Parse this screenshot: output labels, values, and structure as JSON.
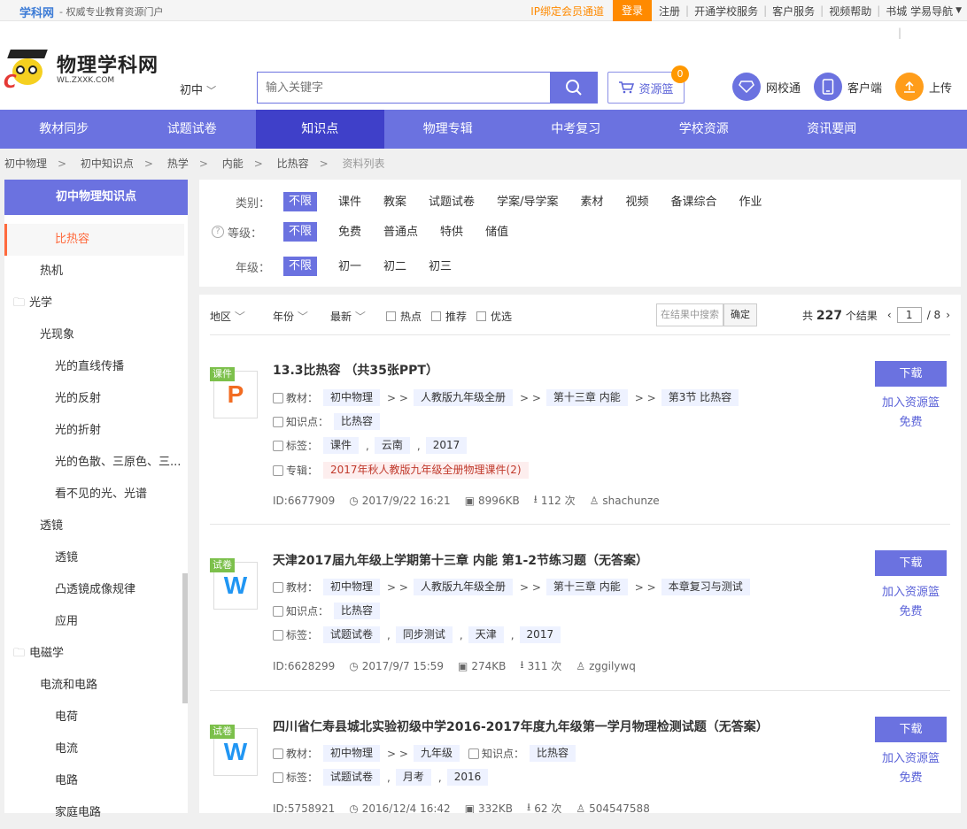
{
  "topbar": {
    "brand": "学科网",
    "slogan": "- 权威专业教育资源门户",
    "links": {
      "vip": "IP绑定会员通道",
      "login": "登录",
      "register": "注册",
      "school": "开通学校服务",
      "service": "客户服务",
      "video": "视频帮助",
      "nav": "书城 学易导航"
    }
  },
  "header": {
    "logo_cn": "物理学科网",
    "logo_en": "WL.ZXXK.COM",
    "level": "初中",
    "search_placeholder": "输入关键字",
    "basket_label": "资源篮",
    "basket_count": "0",
    "links": [
      "网校通",
      "客户端",
      "上传"
    ]
  },
  "nav": [
    "教材同步",
    "试题试卷",
    "知识点",
    "物理专辑",
    "中考复习",
    "学校资源",
    "资讯要闻"
  ],
  "breadcrumb": [
    "初中物理",
    "初中知识点",
    "热学",
    "内能",
    "比热容",
    "资料列表"
  ],
  "sidebar": {
    "title": "初中物理知识点",
    "items": [
      {
        "label": "比热容",
        "level": "sel"
      },
      {
        "label": "热机",
        "level": "l1"
      },
      {
        "label": "光学",
        "level": "l0"
      },
      {
        "label": "光现象",
        "level": "l1"
      },
      {
        "label": "光的直线传播",
        "level": "l2"
      },
      {
        "label": "光的反射",
        "level": "l2"
      },
      {
        "label": "光的折射",
        "level": "l2"
      },
      {
        "label": "光的色散、三原色、三...",
        "level": "l2"
      },
      {
        "label": "看不见的光、光谱",
        "level": "l2"
      },
      {
        "label": "透镜",
        "level": "l1"
      },
      {
        "label": "透镜",
        "level": "l2"
      },
      {
        "label": "凸透镜成像规律",
        "level": "l2"
      },
      {
        "label": "应用",
        "level": "l2"
      },
      {
        "label": "电磁学",
        "level": "l0"
      },
      {
        "label": "电流和电路",
        "level": "l1"
      },
      {
        "label": "电荷",
        "level": "l2"
      },
      {
        "label": "电流",
        "level": "l2"
      },
      {
        "label": "电路",
        "level": "l2"
      },
      {
        "label": "家庭电路",
        "level": "l2"
      }
    ]
  },
  "filters": {
    "category": {
      "label": "类别：",
      "options": [
        "不限",
        "课件",
        "教案",
        "试题试卷",
        "学案/导学案",
        "素材",
        "视频",
        "备课综合",
        "作业"
      ]
    },
    "grade": {
      "label": "等级：",
      "options": [
        "不限",
        "免费",
        "普通点",
        "特供",
        "储值"
      ]
    },
    "year": {
      "label": "年级：",
      "options": [
        "不限",
        "初一",
        "初二",
        "初三"
      ]
    }
  },
  "toolbar": {
    "region": "地区",
    "year": "年份",
    "latest": "最新",
    "checks": [
      "热点",
      "推荐",
      "优选"
    ],
    "search_placeholder": "在结果中搜索",
    "confirm": "确定",
    "count_prefix": "共",
    "count": "227",
    "count_suffix": "个结果",
    "page": "1",
    "pages": "/ 8"
  },
  "results": [
    {
      "type_tag": "课件",
      "icon_letter": "P",
      "title": "13.3比热容 （共35张PPT）",
      "textbook_label": "教材：",
      "textbook": [
        "初中物理",
        "人教版九年级全册",
        "第十三章 内能",
        "第3节 比热容"
      ],
      "kp_label": "知识点：",
      "kp": [
        "比热容"
      ],
      "tag_label": "标签：",
      "tags": [
        "课件",
        "云南",
        "2017"
      ],
      "album_label": "专辑：",
      "album": "2017年秋人教版九年级全册物理课件(2)",
      "id": "ID:6677909",
      "date": "2017/9/22 16:21",
      "size": "8996KB",
      "downloads": "112 次",
      "user": "shachunze",
      "download": "下载",
      "add": "加入资源篮",
      "price": "免费"
    },
    {
      "type_tag": "试卷",
      "icon_letter": "W",
      "title": "天津2017届九年级上学期第十三章 内能 第1-2节练习题（无答案）",
      "textbook_label": "教材：",
      "textbook": [
        "初中物理",
        "人教版九年级全册",
        "第十三章 内能",
        "本章复习与测试"
      ],
      "kp_label": "知识点：",
      "kp": [
        "比热容"
      ],
      "tag_label": "标签：",
      "tags": [
        "试题试卷",
        "同步测试",
        "天津",
        "2017"
      ],
      "id": "ID:6628299",
      "date": "2017/9/7 15:59",
      "size": "274KB",
      "downloads": "311 次",
      "user": "zggilywq",
      "download": "下载",
      "add": "加入资源篮",
      "price": "免费"
    },
    {
      "type_tag": "试卷",
      "icon_letter": "W",
      "title": "四川省仁寿县城北实验初级中学2016-2017年度九年级第一学月物理检测试题（无答案）",
      "textbook_label": "教材：",
      "textbook": [
        "初中物理",
        "九年级"
      ],
      "kp_label": "知识点：",
      "kp": [
        "比热容"
      ],
      "tag_label": "标签：",
      "tags": [
        "试题试卷",
        "月考",
        "2016"
      ],
      "id": "ID:5758921",
      "date": "2016/12/4 16:42",
      "size": "332KB",
      "downloads": "62 次",
      "user": "504547588",
      "download": "下载",
      "add": "加入资源篮",
      "price": "免费"
    }
  ],
  "colors": {
    "primary": "#6b72e0",
    "nav_active": "#3f40c9",
    "accent": "#ff8a00",
    "selected_item": "#ff6a3d"
  }
}
